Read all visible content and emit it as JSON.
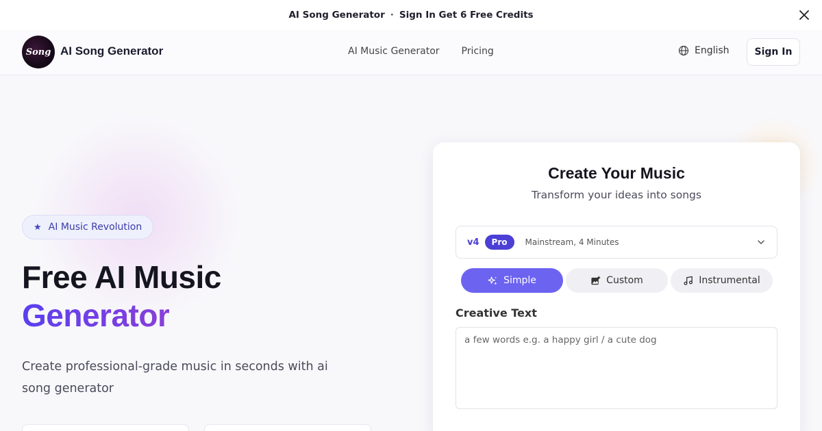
{
  "announcement": {
    "brand": "AI Song Generator",
    "separator": "·",
    "offer": "Sign In Get 6 Free Credits",
    "close_icon": "close-icon"
  },
  "header": {
    "logo_text": "Song",
    "brand": "AI Song Generator",
    "nav": [
      {
        "label": "AI Music Generator"
      },
      {
        "label": "Pricing"
      }
    ],
    "language": "English",
    "signin": "Sign In"
  },
  "hero": {
    "badge": "AI Music Revolution",
    "title_line1": "Free AI Music",
    "title_line2": "Generator",
    "subtitle": "Create professional-grade music in seconds with ai song generator"
  },
  "card": {
    "title": "Create Your Music",
    "subtitle": "Transform your ideas into songs",
    "model": {
      "version": "v4",
      "badge": "Pro",
      "description": "Mainstream, 4 Minutes"
    },
    "tabs": [
      {
        "label": "Simple",
        "icon": "sparkles-icon",
        "active": true
      },
      {
        "label": "Custom",
        "icon": "image-plus-icon",
        "active": false
      },
      {
        "label": "Instrumental",
        "icon": "music-note-icon",
        "active": false
      }
    ],
    "field_label": "Creative Text",
    "field_placeholder": "a few words e.g. a happy girl / a cute dog"
  },
  "colors": {
    "accent": "#6c63f0",
    "brand_purple": "#4b3fd6",
    "gradient_start": "#5b3ff0",
    "gradient_end": "#8a3fd8"
  }
}
